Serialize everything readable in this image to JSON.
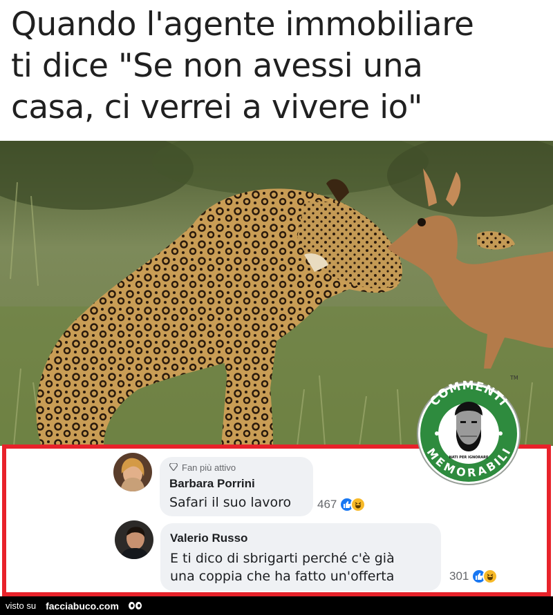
{
  "caption": {
    "text": "Quando l'agente immobiliare\nti dice \"Se non avessi una\ncasa, ci verrei a vivere io\""
  },
  "logo": {
    "top_text": "COMMENTI",
    "bottom_text": "MEMORABILI",
    "small_text": "NATI PER IGNORARE",
    "tm": "TM"
  },
  "comments": [
    {
      "badge": "Fan più attivo",
      "author": "Barbara Porrini",
      "text": "Safari il suo lavoro",
      "reactions_count": "467"
    },
    {
      "author": "Valerio Russo",
      "text_line1": "E ti dico di sbrigarti perché c'è già",
      "text_line2": "una coppia che ha fatto un'offerta",
      "reactions_count": "301"
    }
  ],
  "footer": {
    "visto_su": "visto su",
    "site": "facciabuco.com"
  },
  "colors": {
    "frame": "#e8222a",
    "logo_green": "#2e8b3e",
    "like": "#1877f2",
    "haha": "#f7b928"
  }
}
